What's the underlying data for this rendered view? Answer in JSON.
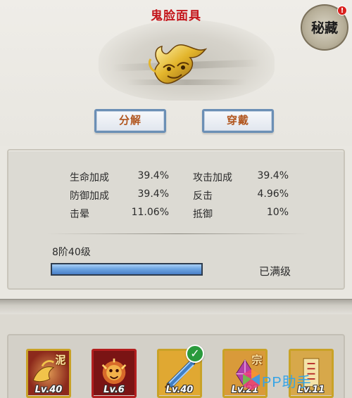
{
  "item": {
    "title": "鬼脸面具",
    "art_icon": "golden-mask-icon"
  },
  "badge": {
    "label": "秘藏",
    "alert": "!"
  },
  "actions": {
    "decompose_label": "分解",
    "wear_label": "穿戴"
  },
  "stats": [
    {
      "name": "生命加成",
      "value": "39.4%"
    },
    {
      "name": "攻击加成",
      "value": "39.4%"
    },
    {
      "name": "防御加成",
      "value": "39.4%"
    },
    {
      "name": "反击",
      "value": "4.96%"
    },
    {
      "name": "击晕",
      "value": "11.06%"
    },
    {
      "name": "抵御",
      "value": "10%"
    }
  ],
  "level": {
    "label": "8阶40级",
    "status": "已满级",
    "progress_percent": 100
  },
  "slots": [
    {
      "level": "Lv.40",
      "tag": "泥",
      "frame": "gold",
      "icon": "bird-beast-icon"
    },
    {
      "level": "Lv.6",
      "tag": "",
      "frame": "red",
      "icon": "lion-head-icon"
    },
    {
      "level": "Lv.40",
      "tag": "",
      "frame": "gold",
      "icon": "fan-icon",
      "equipped": true
    },
    {
      "level": "Lv.21",
      "tag": "宗",
      "frame": "gold",
      "icon": "crystal-icon"
    },
    {
      "level": "Lv.11",
      "tag": "",
      "frame": "gold",
      "icon": "talisman-icon"
    }
  ],
  "watermark": {
    "text": "PP助手"
  },
  "colors": {
    "title_red": "#c4161c",
    "button_border": "#6b8fb5",
    "button_text": "#b1561f",
    "progress_blue": "#4a80c8",
    "check_green": "#2a9a3c"
  }
}
